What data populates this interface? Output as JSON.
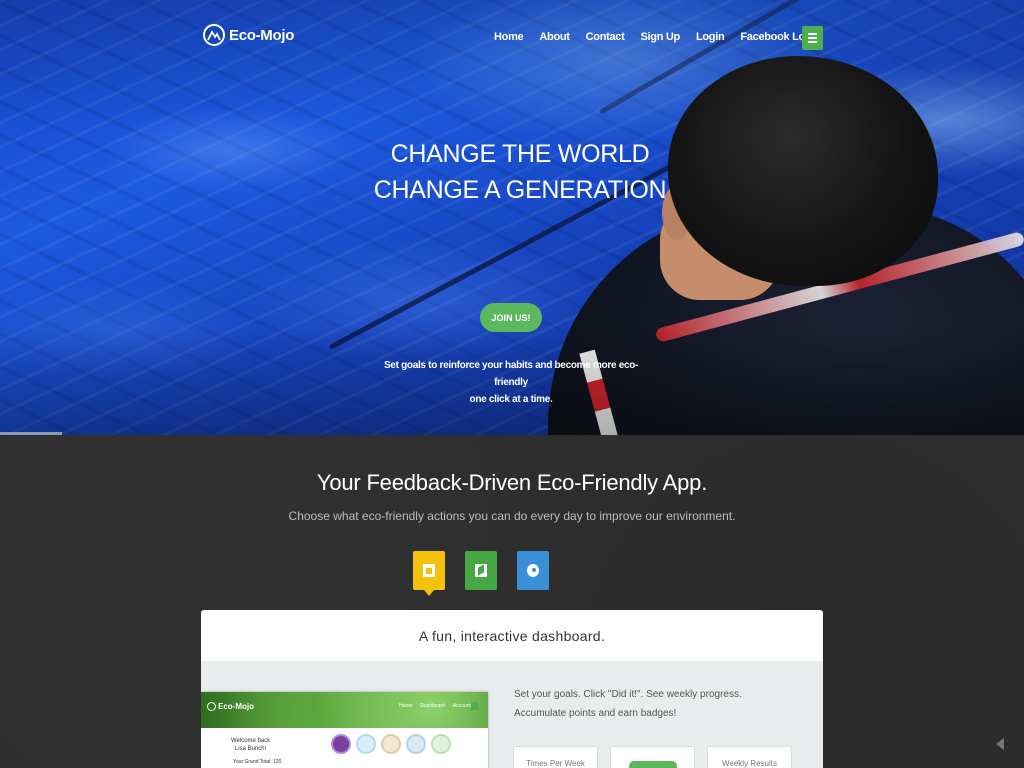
{
  "brand": {
    "name": "Eco-Mojo",
    "logo_icon": "mountain-logo-icon"
  },
  "nav": {
    "items": [
      {
        "label": "Home"
      },
      {
        "label": "About"
      },
      {
        "label": "Contact"
      },
      {
        "label": "Sign Up"
      },
      {
        "label": "Login"
      },
      {
        "label": "Facebook Login"
      }
    ],
    "menu_icon": "hamburger-menu-icon"
  },
  "hero": {
    "title_line1": "CHANGE THE WORLD",
    "title_line2": "CHANGE A GENERATION",
    "cta_label": "JOIN US!",
    "subtitle_line1": "Set goals to reinforce your habits and become more eco-friendly",
    "subtitle_line2": "one click at a time.",
    "colors": {
      "cta": "#5cb85c",
      "water": "#1d5ae0"
    }
  },
  "feature": {
    "title": "Your Feedback-Driven Eco-Friendly App.",
    "subtitle": "Choose what eco-friendly actions you can do every day to improve our environment.",
    "tabs": [
      {
        "icon": "dashboard-icon",
        "color": "#f4c20d"
      },
      {
        "icon": "mobile-icon",
        "color": "#45a845"
      },
      {
        "icon": "social-icon",
        "color": "#3a8fd9"
      }
    ],
    "card": {
      "heading": "A fun, interactive dashboard.",
      "text_line1": "Set your goals. Click \"Did it!\". See weekly progress.",
      "text_line2": "Accumulate points and earn badges!",
      "stats": [
        {
          "label": "Times Per Week"
        },
        {
          "label": ""
        },
        {
          "label": "Weekly Results"
        }
      ],
      "mini_screenshot": {
        "brand": "Eco-Mojo",
        "nav": [
          "Home",
          "Dashboard",
          "Account"
        ],
        "welcome_line1": "Welcome back",
        "welcome_line2": "Lisa Bunch!",
        "grand_total": "Your Grand Total: 120"
      }
    }
  }
}
